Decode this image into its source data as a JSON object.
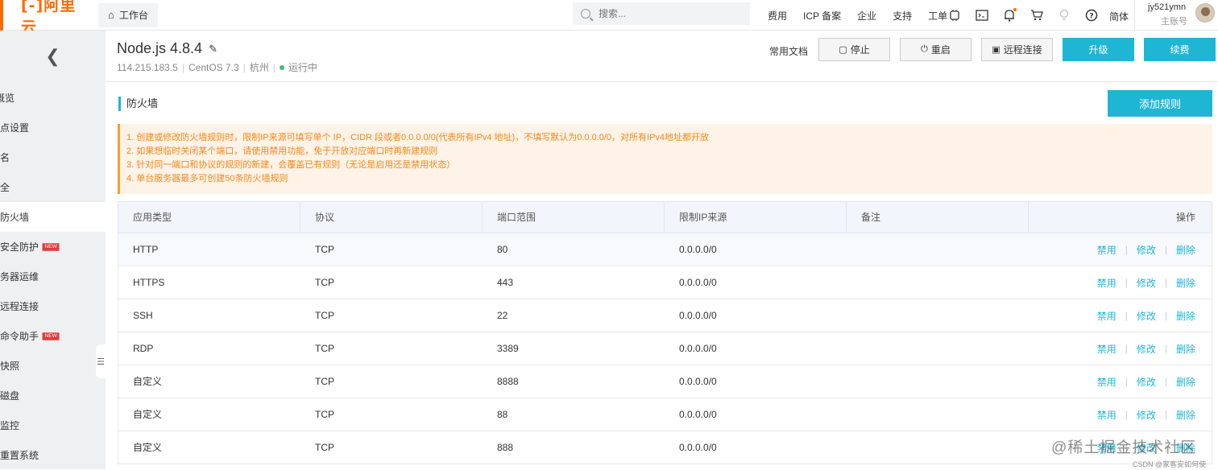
{
  "topbar": {
    "logo": "[-]阿里云",
    "workbench": "工作台",
    "search_placeholder": "搜索...",
    "links": [
      "费用",
      "ICP 备案",
      "企业",
      "支持",
      "工单"
    ],
    "lang": "简体",
    "account_name": "jy521ymn",
    "account_sub": "主账号"
  },
  "sidebar": {
    "items": [
      {
        "label": "概览",
        "badge": ""
      },
      {
        "label": "站点设置",
        "badge": ""
      },
      {
        "label": "域名",
        "badge": ""
      },
      {
        "label": "安全",
        "badge": ""
      },
      {
        "label": "防火墙",
        "badge": ""
      },
      {
        "label": "安全防护",
        "badge": "NEW"
      },
      {
        "label": "服务器运维",
        "badge": ""
      },
      {
        "label": "远程连接",
        "badge": ""
      },
      {
        "label": "命令助手",
        "badge": "NEW"
      },
      {
        "label": "快照",
        "badge": ""
      },
      {
        "label": "磁盘",
        "badge": ""
      },
      {
        "label": "监控",
        "badge": ""
      },
      {
        "label": "重置系统",
        "badge": ""
      }
    ]
  },
  "header": {
    "title": "Node.js 4.8.4",
    "ip": "114.215.183.5",
    "os": "CentOS  7.3",
    "region": "杭州",
    "status": "运行中",
    "docs": "常用文档",
    "stop": "停止",
    "restart": "重启",
    "remote": "远程连接",
    "upgrade": "升级",
    "renew": "续费"
  },
  "firewall": {
    "title": "防火墙",
    "add_rule": "添加规则",
    "notices": [
      "1. 创建或修改防火墙规则时，限制IP来源可填写单个 IP，CIDR 段或者0.0.0.0/0(代表所有IPv4 地址)，不填写默认为0.0.0.0/0，对所有IPv4地址都开放",
      "2. 如果想临时关闭某个端口，请使用禁用功能，免于开放对应端口时再新建规则",
      "3. 针对同一端口和协议的规则的新建，会覆盖已有规则（无论是启用还是禁用状态）",
      "4. 单台服务器最多可创建50条防火墙规则"
    ],
    "columns": [
      "应用类型",
      "协议",
      "端口范围",
      "限制IP来源",
      "备注",
      "操作"
    ],
    "actions": [
      "禁用",
      "修改",
      "删除"
    ],
    "rows": [
      {
        "type": "HTTP",
        "protocol": "TCP",
        "port": "80",
        "ip": "0.0.0.0/0",
        "note": ""
      },
      {
        "type": "HTTPS",
        "protocol": "TCP",
        "port": "443",
        "ip": "0.0.0.0/0",
        "note": ""
      },
      {
        "type": "SSH",
        "protocol": "TCP",
        "port": "22",
        "ip": "0.0.0.0/0",
        "note": ""
      },
      {
        "type": "RDP",
        "protocol": "TCP",
        "port": "3389",
        "ip": "0.0.0.0/0",
        "note": ""
      },
      {
        "type": "自定义",
        "protocol": "TCP",
        "port": "8888",
        "ip": "0.0.0.0/0",
        "note": ""
      },
      {
        "type": "自定义",
        "protocol": "TCP",
        "port": "88",
        "ip": "0.0.0.0/0",
        "note": ""
      },
      {
        "type": "自定义",
        "protocol": "TCP",
        "port": "888",
        "ip": "0.0.0.0/0",
        "note": ""
      }
    ]
  },
  "watermark": {
    "main": "@稀土掘金技术社区",
    "sub": "CSDN @家客安如何使"
  },
  "colors": {
    "accent": "#1fb6d4",
    "brand": "#ff6a00",
    "notice_text": "#f08a1c",
    "status_ok": "#3fbe74"
  }
}
